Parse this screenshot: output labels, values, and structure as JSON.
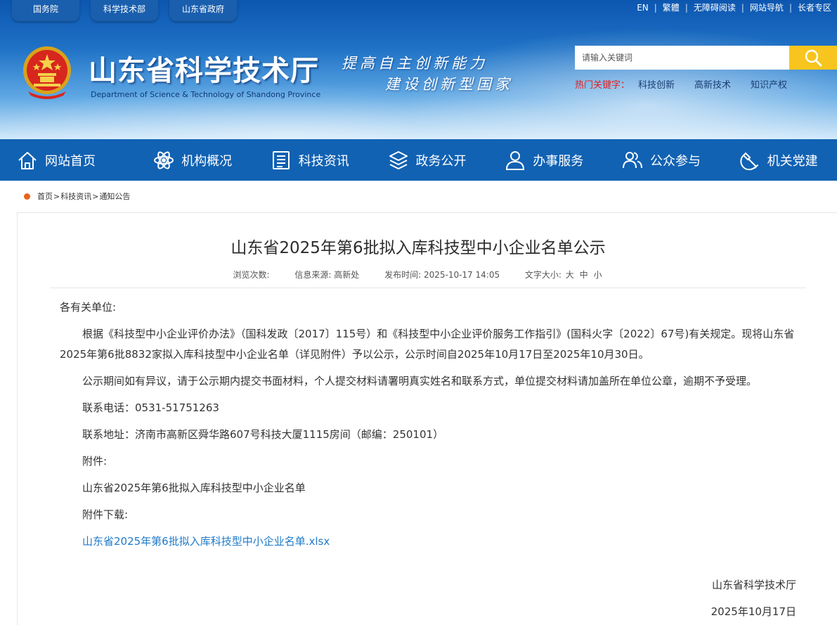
{
  "top_links": [
    "国务院",
    "科学技术部",
    "山东省政府"
  ],
  "util_links": [
    "EN",
    "繁體",
    "无障碍阅读",
    "网站导航",
    "长者专区"
  ],
  "site": {
    "title": "山东省科学技术厅",
    "subtitle": "Department of Science & Technology of Shandong Province",
    "slogan_line1": "提高自主创新能力",
    "slogan_line2": "建设创新型国家"
  },
  "search": {
    "placeholder": "请输入关键词",
    "hot_label": "热门关键字：",
    "hot_words": [
      "科技创新",
      "高新技术",
      "知识产权"
    ]
  },
  "nav": [
    {
      "label": "网站首页",
      "icon": "home-icon"
    },
    {
      "label": "机构概况",
      "icon": "atom-icon"
    },
    {
      "label": "科技资讯",
      "icon": "document-list-icon"
    },
    {
      "label": "政务公开",
      "icon": "layers-icon"
    },
    {
      "label": "办事服务",
      "icon": "person-icon"
    },
    {
      "label": "公众参与",
      "icon": "people-icon"
    },
    {
      "label": "机关党建",
      "icon": "party-emblem-icon"
    }
  ],
  "breadcrumb": [
    "首页",
    "科技资讯",
    "通知公告"
  ],
  "breadcrumb_sep": ">",
  "article": {
    "title": "山东省2025年第6批拟入库科技型中小企业名单公示",
    "meta": {
      "views_label": "浏览次数:",
      "source_label": "信息来源:",
      "source": "高新处",
      "time_label": "发布时间:",
      "time": "2025-10-17 14:05",
      "fontsize_label": "文字大小:",
      "fontsize_options": [
        "大",
        "中",
        "小"
      ]
    },
    "salutation": "各有关单位:",
    "para1": "根据《科技型中小企业评价办法》（国科发政〔2017〕115号）和《科技型中小企业评价服务工作指引》(国科火字〔2022〕67号)有关规定。现将山东省2025年第6批8832家拟入库科技型中小企业名单（详见附件）予以公示，公示时间自2025年10月17日至2025年10月30日。",
    "para2": "公示期间如有异议，请于公示期内提交书面材料，个人提交材料请署明真实姓名和联系方式，单位提交材料请加盖所在单位公章，逾期不予受理。",
    "phone": "联系电话：0531-51751263",
    "address": "联系地址：济南市高新区舜华路607号科技大厦1115房间（邮编：250101）",
    "attachment_label": "附件:",
    "attachment_name": "山东省2025年第6批拟入库科技型中小企业名单",
    "download_label": "附件下载:",
    "download_link": "山东省2025年第6批拟入库科技型中小企业名单.xlsx",
    "signoff_org": "山东省科学技术厅",
    "signoff_date": "2025年10月17日"
  },
  "colors": {
    "nav_bg": "#1162b3",
    "search_button": "#f7c51d",
    "hot_label": "#e02020",
    "link": "#1e7ac9",
    "breadcrumb_dot": "#e8641c"
  }
}
